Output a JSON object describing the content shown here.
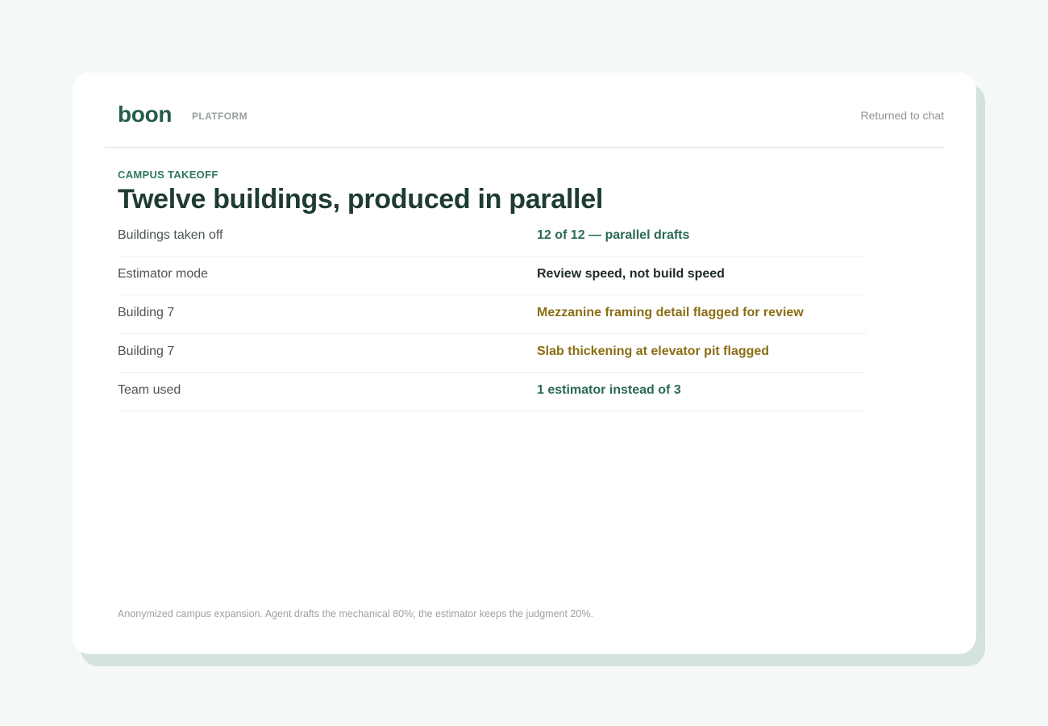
{
  "header": {
    "brand": "boon",
    "section": "PLATFORM",
    "status": "Returned to chat"
  },
  "main": {
    "eyebrow": "CAMPUS TAKEOFF",
    "title": "Twelve buildings, produced in parallel",
    "rows": [
      {
        "label": "Buildings taken off",
        "value": "12 of 12 — parallel drafts",
        "tone": "green"
      },
      {
        "label": "Estimator mode",
        "value": "Review speed, not build speed",
        "tone": "dark"
      },
      {
        "label": "Building 7",
        "value": "Mezzanine framing detail flagged for review",
        "tone": "amber"
      },
      {
        "label": "Building 7",
        "value": "Slab thickening at elevator pit flagged",
        "tone": "amber"
      },
      {
        "label": "Team used",
        "value": "1 estimator instead of 3",
        "tone": "green"
      }
    ],
    "footnote": "Anonymized campus expansion. Agent drafts the mechanical 80%; the estimator keeps the judgment 20%."
  },
  "colors": {
    "brand": "#245d4a",
    "accent_green": "#2b6a52",
    "flag_amber": "#8a6d14",
    "title": "#1f3b33",
    "background": "#f4f9f7"
  }
}
